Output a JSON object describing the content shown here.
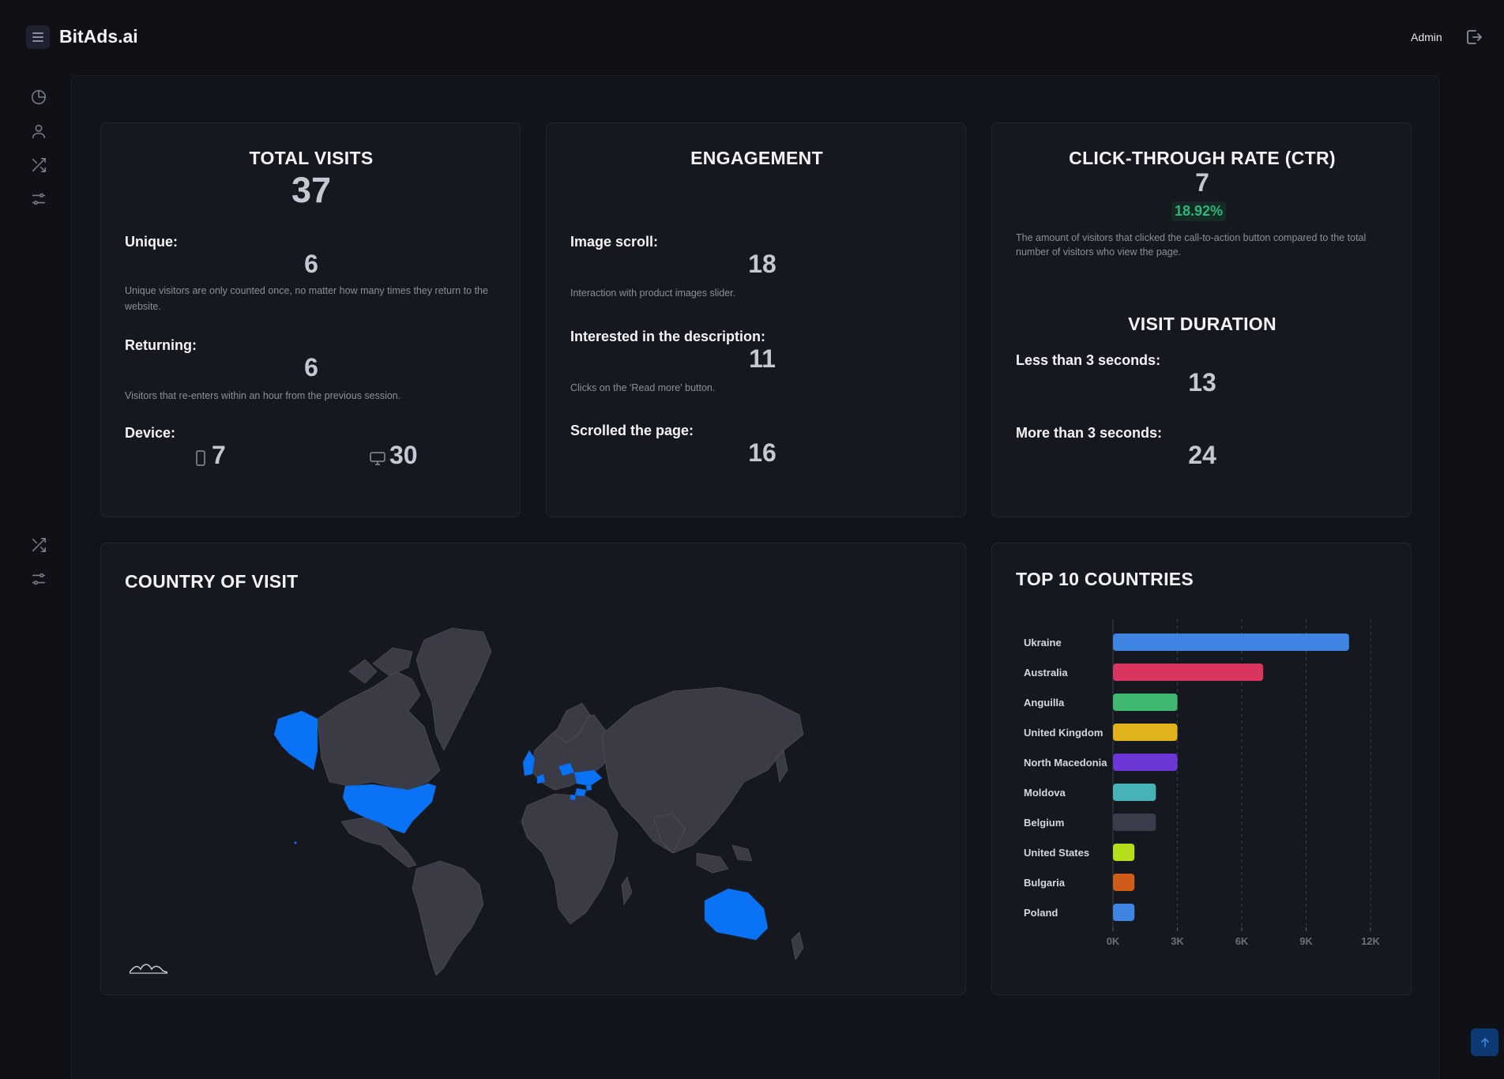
{
  "app": {
    "title": "BitAds.ai"
  },
  "header": {
    "user_label": "Admin"
  },
  "sidebar": {
    "icons": [
      "pie-chart-icon",
      "user-icon",
      "shuffle-icon",
      "sliders-icon",
      "shuffle-icon",
      "sliders-icon"
    ]
  },
  "total_visits": {
    "title": "TOTAL VISITS",
    "value": "37",
    "unique_label": "Unique:",
    "unique_value": "6",
    "unique_desc": "Unique visitors are only counted once, no matter how many times they return to the website.",
    "returning_label": "Returning:",
    "returning_value": "6",
    "returning_desc": "Visitors that re-enters within an hour from the previous session.",
    "device_label": "Device:",
    "mobile_value": "7",
    "desktop_value": "30"
  },
  "engagement": {
    "title": "ENGAGEMENT",
    "image_scroll_label": "Image scroll:",
    "image_scroll_value": "18",
    "image_scroll_desc": "Interaction with product images slider.",
    "description_label": "Interested in the description:",
    "description_value": "11",
    "description_desc": "Clicks on the 'Read more' button.",
    "scrolled_label": "Scrolled the page:",
    "scrolled_value": "16"
  },
  "ctr": {
    "title": "CLICK-THROUGH RATE (CTR)",
    "value": "7",
    "percent": "18.92%",
    "percent_color": "#2fb47c",
    "desc": "The amount of visitors that clicked the call-to-action button compared to the total number of visitors who view the page."
  },
  "visit_duration": {
    "title": "VISIT DURATION",
    "less_label": "Less than 3 seconds:",
    "less_value": "13",
    "more_label": "More than 3 seconds:",
    "more_value": "24"
  },
  "country_map": {
    "title": "COUNTRY OF VISIT",
    "highlight_color": "#0a72f5",
    "base_color": "#3a3b44",
    "highlighted": [
      "United States",
      "Alaska",
      "Australia",
      "Ukraine",
      "United Kingdom",
      "Belgium",
      "Poland",
      "Moldova",
      "Bulgaria",
      "North Macedonia",
      "Anguilla"
    ]
  },
  "chart_data": {
    "type": "bar",
    "orientation": "horizontal",
    "title": "TOP 10 COUNTRIES",
    "categories": [
      "Ukraine",
      "Australia",
      "Anguilla",
      "United Kingdom",
      "North Macedonia",
      "Moldova",
      "Belgium",
      "United States",
      "Bulgaria",
      "Poland"
    ],
    "values": [
      11000,
      7000,
      3000,
      3000,
      3000,
      2000,
      2000,
      1000,
      1000,
      1000
    ],
    "colors": [
      "#3d85e0",
      "#d9365f",
      "#3fb872",
      "#e0b21b",
      "#6b37d6",
      "#45b3b8",
      "#3b3d4b",
      "#b3e01b",
      "#cf5d19",
      "#3d85e0"
    ],
    "xlim": [
      0,
      12000
    ],
    "xticks": [
      "0K",
      "3K",
      "6K",
      "9K",
      "12K"
    ],
    "grid": true,
    "legend": "none"
  }
}
